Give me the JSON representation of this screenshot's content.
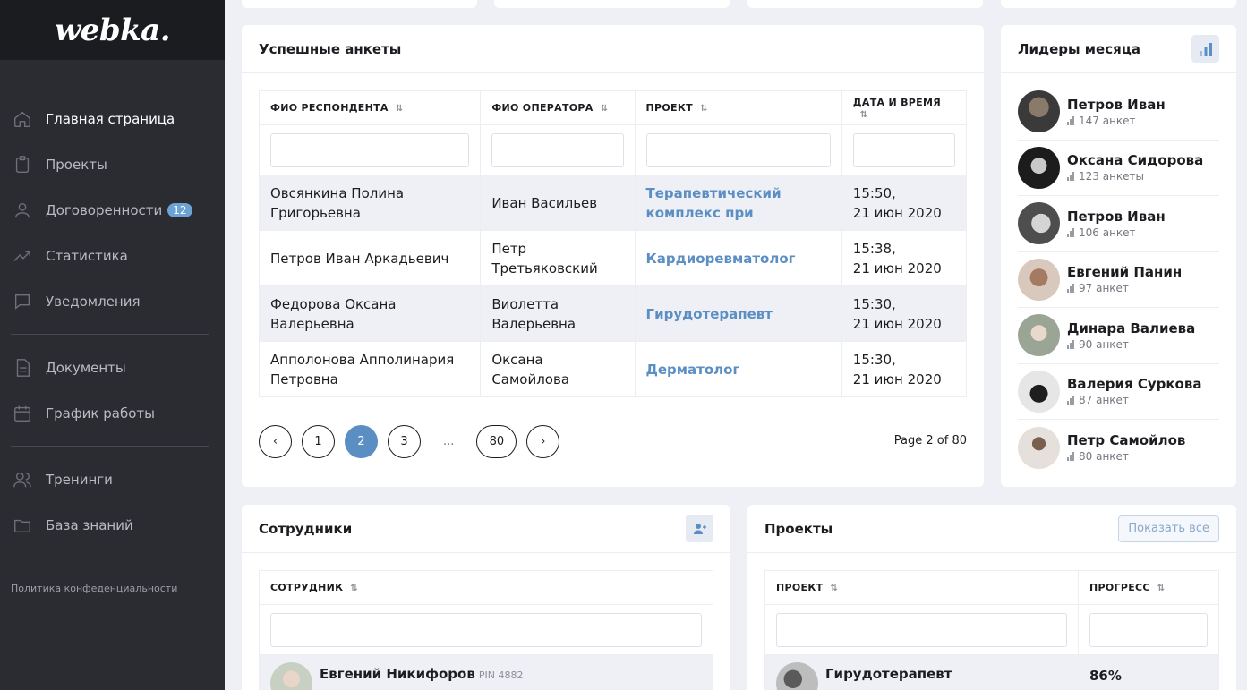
{
  "app": {
    "logo": "webka."
  },
  "sidebar": {
    "items": [
      {
        "label": "Главная страница",
        "icon": "home-icon"
      },
      {
        "label": "Проекты",
        "icon": "clipboard-icon"
      },
      {
        "label": "Договоренности",
        "icon": "user-icon",
        "badge": "12"
      },
      {
        "label": "Статистика",
        "icon": "trend-icon"
      },
      {
        "label": "Уведомления",
        "icon": "chat-icon"
      },
      {
        "label": "Документы",
        "icon": "document-icon"
      },
      {
        "label": "График работы",
        "icon": "calendar-icon"
      },
      {
        "label": "Тренинги",
        "icon": "users-icon"
      },
      {
        "label": "База знаний",
        "icon": "folder-icon"
      }
    ],
    "privacy": "Политика конфеденциальности"
  },
  "surveys": {
    "title": "Успешные анкеты",
    "columns": [
      "ФИО РЕСПОНДЕНТА",
      "ФИО ОПЕРАТОРА",
      "ПРОЕКТ",
      "ДАТА И ВРЕМЯ"
    ],
    "rows": [
      {
        "respondent": "Овсянкина Полина Григорьевна",
        "operator": "Иван Васильев",
        "project": "Терапевтический комплекс при",
        "time": "15:50,",
        "date": "21 июн 2020"
      },
      {
        "respondent": "Петров Иван Аркадьевич",
        "operator": "Петр Третьяковский",
        "project": "Кардиоревматолог",
        "time": "15:38,",
        "date": "21 июн 2020"
      },
      {
        "respondent": "Федорова Оксана Валерьевна",
        "operator": "Виолетта Валерьевна",
        "project": "Гирудотерапевт",
        "time": "15:30,",
        "date": "21 июн 2020"
      },
      {
        "respondent": "Апполонова Апполинария Петровна",
        "operator": "Оксана Самойлова",
        "project": "Дерматолог",
        "time": "15:30,",
        "date": "21 июн 2020"
      }
    ],
    "pagination": {
      "prev": "‹",
      "pages": [
        "1",
        "2",
        "3"
      ],
      "dots": "...",
      "last": "80",
      "next": "›",
      "info": "Page 2 of 80"
    }
  },
  "leaders": {
    "title": "Лидеры месяца",
    "items": [
      {
        "name": "Петров Иван",
        "count": "147 анкет",
        "avatar_color": "#4a4a4a"
      },
      {
        "name": "Оксана Сидорова",
        "count": "123 анкеты",
        "avatar_color": "#2a2a2a"
      },
      {
        "name": "Петров Иван",
        "count": "106 анкет",
        "avatar_color": "#6a6a6a"
      },
      {
        "name": "Евгений Панин",
        "count": "97 анкет",
        "avatar_color": "#c7a28a"
      },
      {
        "name": "Динара Валиева",
        "count": "90 анкет",
        "avatar_color": "#a8b1a0"
      },
      {
        "name": "Валерия Суркова",
        "count": "87 анкет",
        "avatar_color": "#d9d9d9"
      },
      {
        "name": "Петр Самойлов",
        "count": "80 анкет",
        "avatar_color": "#cfc7bf"
      }
    ]
  },
  "employees": {
    "title": "Сотрудники",
    "column": "СОТРУДНИК",
    "first": {
      "name": "Евгений Никифоров",
      "pin": "PIN 4882"
    }
  },
  "projects": {
    "title": "Проекты",
    "show_all": "Показать все",
    "columns": [
      "ПРОЕКТ",
      "ПРОГРЕСС"
    ],
    "first": {
      "name": "Гирудотерапевт",
      "progress": "86%"
    }
  },
  "colors": {
    "accent": "#5b8fc4",
    "sidebar": "#2b2c32",
    "logo_bar": "#1b1c20"
  }
}
